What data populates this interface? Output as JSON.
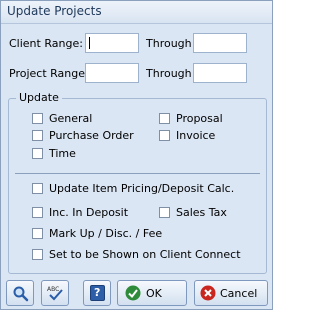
{
  "window": {
    "title": "Update Projects"
  },
  "client": {
    "label": "Client Range:",
    "through": "Through",
    "from_value": "",
    "to_value": ""
  },
  "project": {
    "label": "Project Range:",
    "through": "Through",
    "from_value": "",
    "to_value": ""
  },
  "update": {
    "title": "Update",
    "options": {
      "general": {
        "label": "General",
        "checked": false
      },
      "proposal": {
        "label": "Proposal",
        "checked": false
      },
      "purchase_order": {
        "label": "Purchase Order",
        "checked": false
      },
      "invoice": {
        "label": "Invoice",
        "checked": false
      },
      "time": {
        "label": "Time",
        "checked": false
      },
      "update_item_pricing": {
        "label": "Update Item Pricing/Deposit Calc.",
        "checked": false
      },
      "inc_in_deposit": {
        "label": "Inc. In Deposit",
        "checked": false
      },
      "sales_tax": {
        "label": "Sales Tax",
        "checked": false
      },
      "markup": {
        "label": "Mark Up / Disc. / Fee",
        "checked": false
      },
      "client_connect": {
        "label": "Set to be Shown on Client Connect",
        "checked": false
      }
    }
  },
  "buttons": {
    "search_icon": "magnifier-icon",
    "spell_icon": "spellcheck-icon",
    "help_icon": "help-icon",
    "help_glyph": "?",
    "ok_label": "OK",
    "cancel_label": "Cancel"
  }
}
